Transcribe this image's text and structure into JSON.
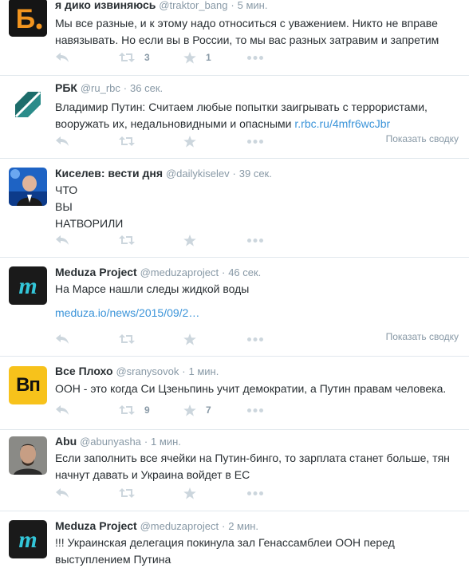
{
  "tweets": [
    {
      "fullname": "я дико извиняюсь",
      "username": "@traktor_bang",
      "sep": "·",
      "time": "5 мин.",
      "text": "Мы все разные, и к этому надо относиться с уважением. Никто не вправе навязывать. Но если вы в России, то мы вас разных затравим и запретим",
      "retweets": "3",
      "favorites": "1",
      "avatar_icon": "b-letter-logo"
    },
    {
      "fullname": "РБК",
      "username": "@ru_rbc",
      "sep": "·",
      "time": "36 сек.",
      "text": "Владимир Путин: Считаем любые попытки заигрывать с террористами, вооружать их, недальновидными и опасными",
      "link": "r.rbc.ru/4mfr6wcJbr",
      "summary": "Показать сводку",
      "avatar_icon": "rbc-logo"
    },
    {
      "fullname": "Киселев: вести дня",
      "username": "@dailykiselev",
      "sep": "·",
      "time": "39 сек.",
      "lines": [
        "ЧТО",
        "ВЫ",
        "НАТВОРИЛИ"
      ],
      "avatar_icon": "news-anchor-photo"
    },
    {
      "fullname": "Meduza Project",
      "username": "@meduzaproject",
      "sep": "·",
      "time": "46 сек.",
      "text": "На Марсе нашли следы жидкой воды",
      "link": "meduza.io/news/2015/09/2…",
      "summary": "Показать сводку",
      "avatar_icon": "meduza-logo"
    },
    {
      "fullname": "Все Плохо",
      "username": "@sranysovok",
      "sep": "·",
      "time": "1 мин.",
      "text": "ООН - это когда Си Цзеньпинь учит демократии, а Путин правам человека.",
      "retweets": "9",
      "favorites": "7",
      "avatar_text": "Вп",
      "avatar_icon": "vp-logo"
    },
    {
      "fullname": "Abu",
      "username": "@abunyasha",
      "sep": "·",
      "time": "1 мин.",
      "text": "Если заполнить все ячейки на Путин-бинго, то зарплата станет больше, тян начнут давать и Украина войдет в ЕС",
      "avatar_icon": "person-photo"
    },
    {
      "fullname": "Meduza Project",
      "username": "@meduzaproject",
      "sep": "·",
      "time": "2 мин.",
      "text": "!!! Украинская делегация покинула зал Генассамблеи ООН перед выступлением Путина",
      "avatar_icon": "meduza-logo"
    }
  ],
  "colors": {
    "action_icon": "#ccd6dd",
    "secondary_text": "#8899a6",
    "link": "#3b94d9",
    "divider": "#e1e8ed"
  },
  "icons": {
    "reply": "reply-icon",
    "retweet": "retweet-icon",
    "favorite": "star-icon",
    "more": "more-dots-icon"
  }
}
